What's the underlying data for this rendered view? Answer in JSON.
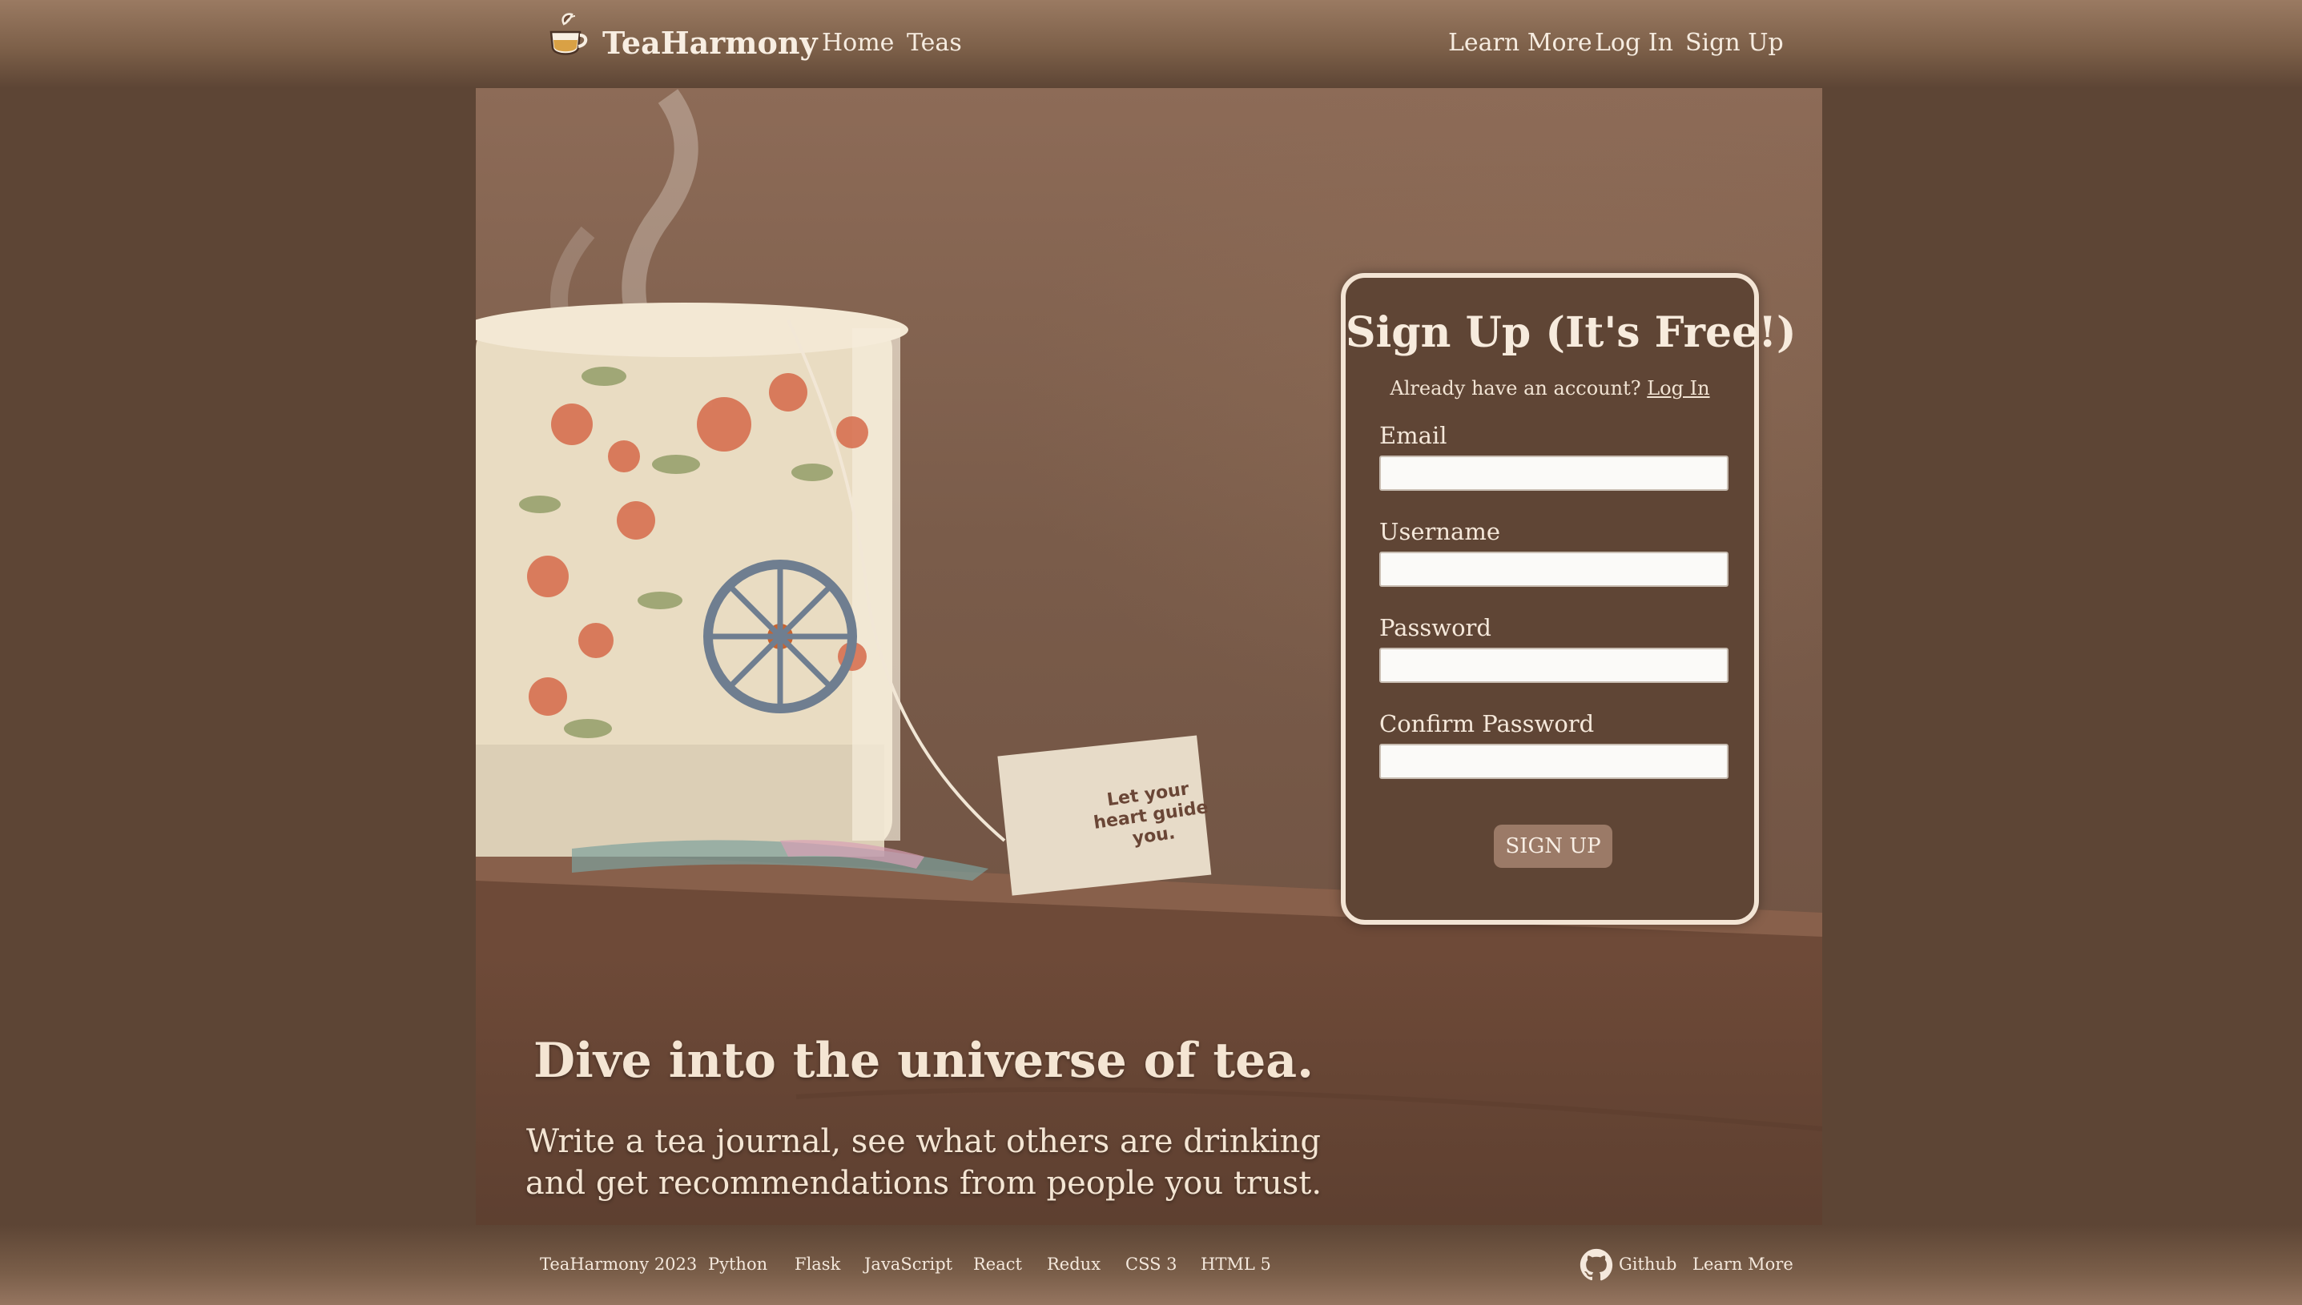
{
  "header": {
    "brand": "TeaHarmony",
    "nav_left": [
      "Home",
      "Teas"
    ],
    "nav_right": [
      "Learn More",
      "Log In",
      "Sign Up"
    ]
  },
  "signup": {
    "title": "Sign Up (It's Free!)",
    "subtitle_prefix": "Already have an account?",
    "login_link": "Log In",
    "fields": [
      {
        "label": "Email",
        "value": ""
      },
      {
        "label": "Username",
        "value": ""
      },
      {
        "label": "Password",
        "value": ""
      },
      {
        "label": "Confirm Password",
        "value": ""
      }
    ],
    "button": "SIGN UP"
  },
  "hero": {
    "title": "Dive into the universe of tea.",
    "subtitle": "Write a tea journal, see what others are drinking and get recommendations from people you trust.",
    "tea_tag_text": "Let your heart guide you."
  },
  "footer": {
    "items": [
      "TeaHarmony 2023",
      "Python",
      "Flask",
      "JavaScript",
      "React",
      "Redux",
      "CSS 3",
      "HTML 5"
    ],
    "github": "Github",
    "learn_more": "Learn More"
  },
  "colors": {
    "background": "#5d4535",
    "card": "#5f4535",
    "card_border": "#f3e4d4",
    "button": "#9b7a67",
    "text": "#f3e6d6"
  },
  "icons": [
    "teacup-logo-icon",
    "github-icon"
  ]
}
